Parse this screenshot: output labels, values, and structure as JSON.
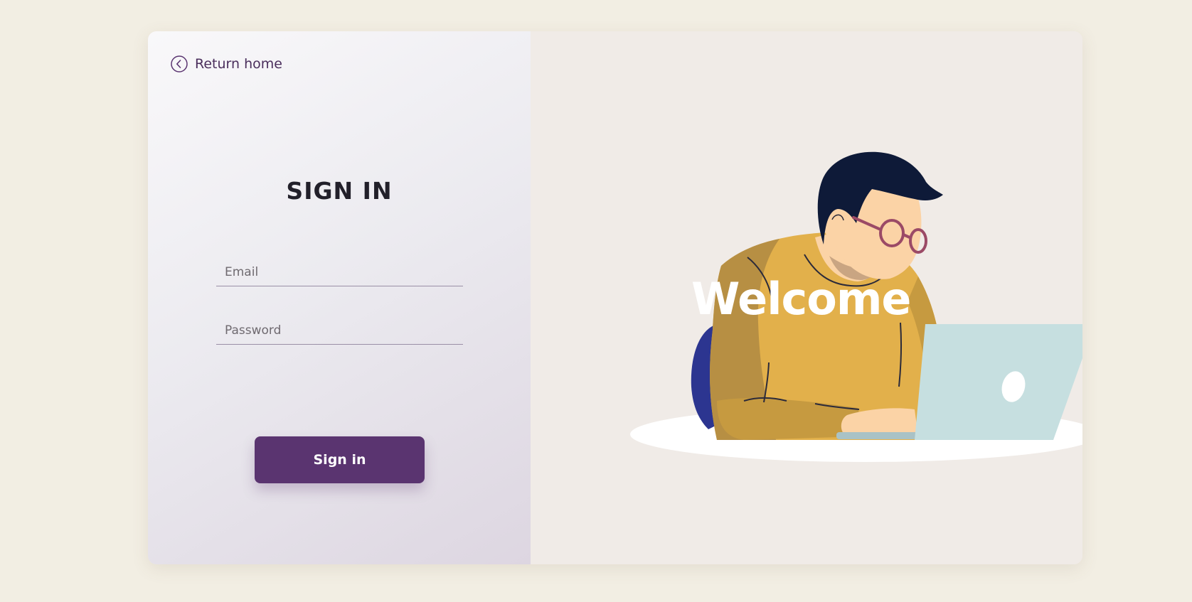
{
  "nav": {
    "return_home_label": "Return home"
  },
  "form": {
    "title": "SIGN IN",
    "email_placeholder": "Email",
    "email_value": "",
    "password_placeholder": "Password",
    "password_value": "",
    "submit_label": "Sign in"
  },
  "hero": {
    "welcome_text": "Welcome"
  },
  "icons": {
    "back": "chevron-left-circle-icon",
    "illustration": "person-at-laptop-illustration"
  },
  "colors": {
    "page_background": "#f2eee3",
    "accent": "#5a3470",
    "right_panel": "#f0ebe7",
    "sweater": "#e2b04b",
    "laptop": "#c6dfe0",
    "hair": "#0e1a38",
    "skin": "#fbd3a6"
  }
}
